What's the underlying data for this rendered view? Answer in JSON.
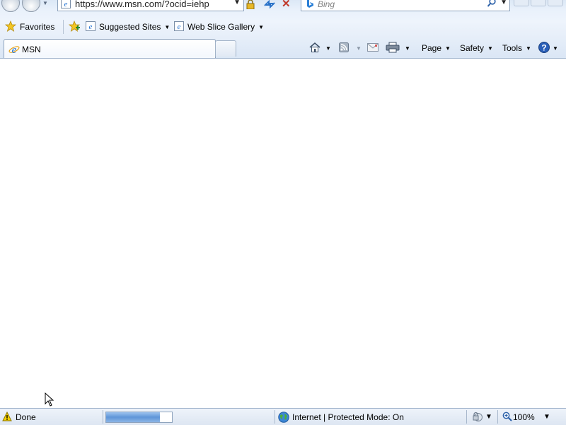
{
  "address": {
    "url": "https://www.msn.com/?ocid=iehp"
  },
  "search": {
    "placeholder": "Bing"
  },
  "favorites_bar": {
    "favorites_label": "Favorites",
    "items": [
      {
        "label": "Suggested Sites",
        "icon": "ie-icon"
      },
      {
        "label": "Web Slice Gallery",
        "icon": "ie-icon"
      }
    ]
  },
  "tabs": [
    {
      "title": "MSN",
      "active": true
    }
  ],
  "command_bar": {
    "page_label": "Page",
    "safety_label": "Safety",
    "tools_label": "Tools"
  },
  "status_bar": {
    "status_text": "Done",
    "progress_fraction": 0.82,
    "zone_text": "Internet | Protected Mode: On",
    "zoom_text": "100%"
  },
  "colors": {
    "chrome_blue": "#dce8f6",
    "progress_blue": "#5f95d8",
    "stop_red": "#c0392b"
  }
}
